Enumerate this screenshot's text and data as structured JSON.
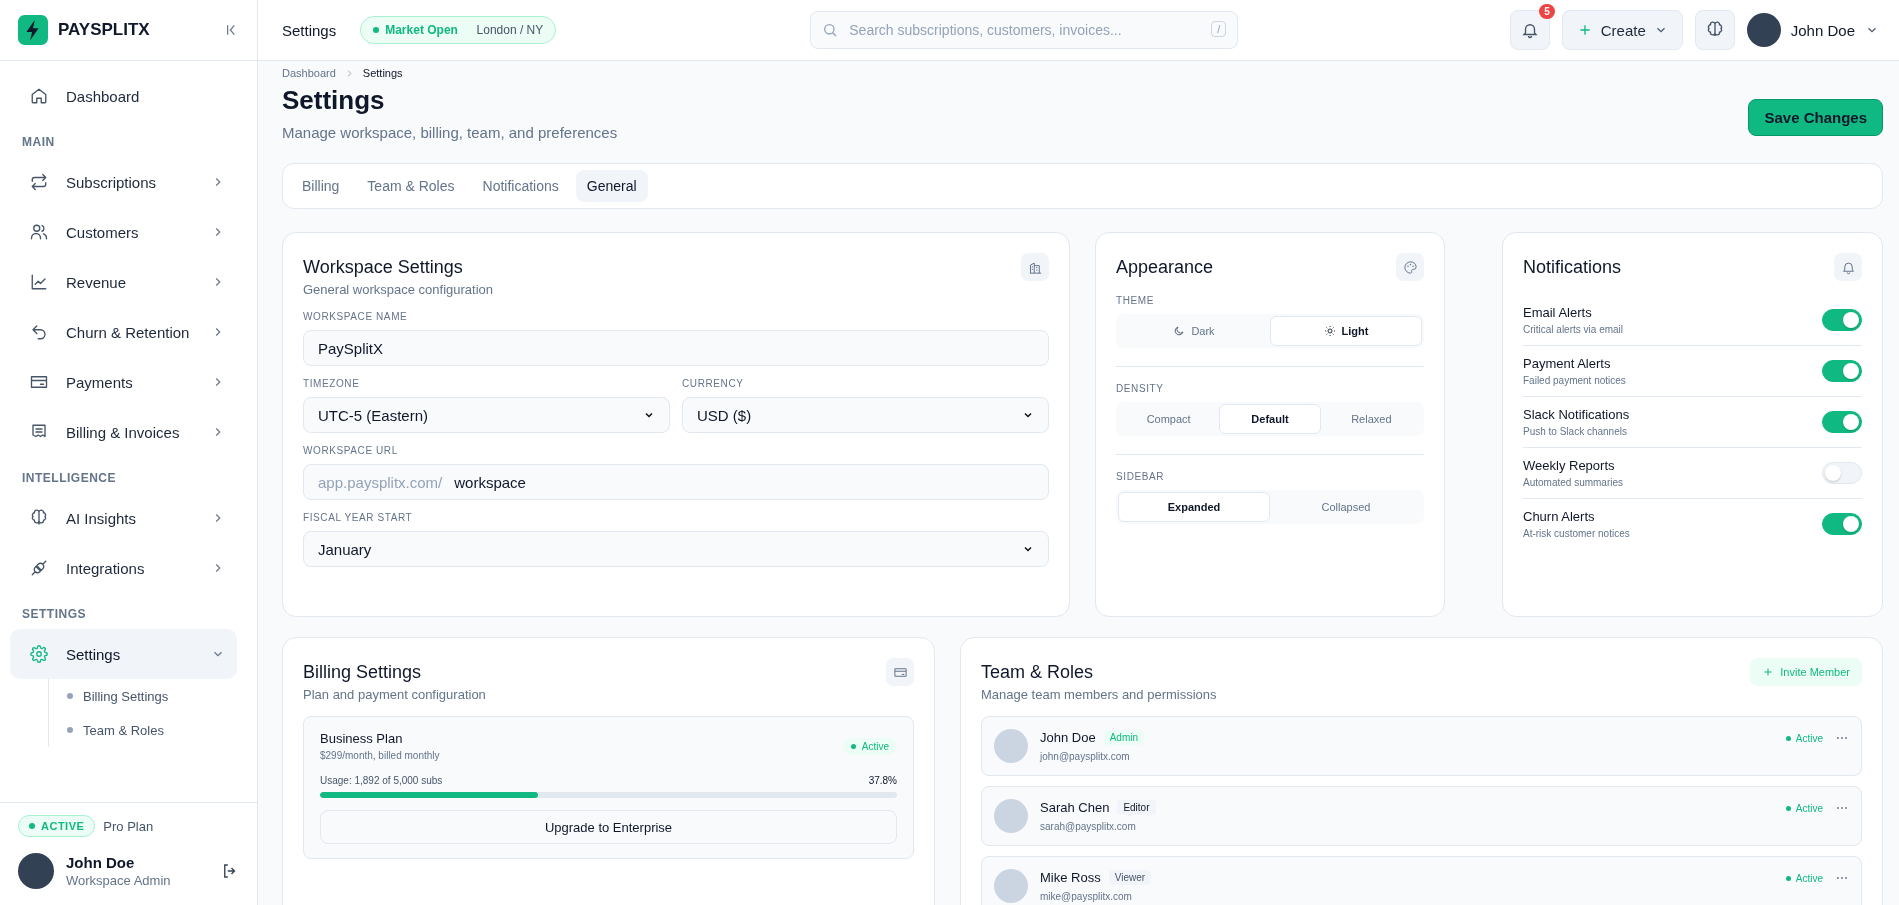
{
  "brand": {
    "name": "PAYSPLITX"
  },
  "sidebar": {
    "nav": [
      {
        "kind": "item",
        "label": "Dashboard",
        "selected": false
      },
      {
        "kind": "section",
        "label": "MAIN"
      },
      {
        "kind": "item",
        "label": "Subscriptions",
        "selected": false,
        "expanded": false
      },
      {
        "kind": "item",
        "label": "Customers",
        "selected": false,
        "expanded": false
      },
      {
        "kind": "item",
        "label": "Revenue",
        "selected": false,
        "expanded": false
      },
      {
        "kind": "item",
        "label": "Churn & Retention",
        "selected": false,
        "expanded": false
      },
      {
        "kind": "item",
        "label": "Payments",
        "selected": false,
        "expanded": false
      },
      {
        "kind": "item",
        "label": "Billing & Invoices",
        "selected": false,
        "expanded": false
      },
      {
        "kind": "section",
        "label": "INTELLIGENCE"
      },
      {
        "kind": "item",
        "label": "AI Insights",
        "selected": false,
        "expanded": false
      },
      {
        "kind": "item",
        "label": "Integrations",
        "selected": false,
        "expanded": false
      },
      {
        "kind": "section",
        "label": "SETTINGS"
      },
      {
        "kind": "item",
        "label": "Settings",
        "selected": true,
        "expanded": true,
        "children": [
          {
            "label": "Billing Settings"
          },
          {
            "label": "Team & Roles"
          }
        ]
      }
    ],
    "plan": {
      "badge": "ACTIVE",
      "name": "Pro Plan"
    },
    "user": {
      "name": "John Doe",
      "role": "Workspace Admin"
    }
  },
  "topbar": {
    "title": "Settings",
    "market": {
      "status": "Market Open",
      "location": "London / NY"
    },
    "search": {
      "placeholder": "Search subscriptions, customers, invoices...",
      "shortcut": "/"
    },
    "notification_count": "5",
    "create": "Create",
    "user": "John Doe"
  },
  "page": {
    "breadcrumb": [
      "Dashboard",
      "Settings"
    ],
    "title": "Settings",
    "subtitle": "Manage workspace, billing, team, and preferences",
    "save": "Save Changes",
    "tabs": [
      {
        "label": "Billing",
        "selected": false
      },
      {
        "label": "Team & Roles",
        "selected": false
      },
      {
        "label": "Notifications",
        "selected": false
      },
      {
        "label": "General",
        "selected": true
      }
    ]
  },
  "workspace": {
    "title": "Workspace Settings",
    "subtitle": "General workspace configuration",
    "name": {
      "label": "WORKSPACE NAME",
      "value": "PaySplitX"
    },
    "timezone": {
      "label": "TIMEZONE",
      "value": "UTC-5 (Eastern)"
    },
    "currency": {
      "label": "CURRENCY",
      "value": "USD ($)"
    },
    "url": {
      "label": "WORKSPACE URL",
      "prefix": "app.paysplitx.com/",
      "value": "workspace"
    },
    "fiscal": {
      "label": "FISCAL YEAR START",
      "value": "January"
    }
  },
  "appearance": {
    "title": "Appearance",
    "groups": [
      {
        "label": "THEME",
        "options": [
          {
            "label": "Dark",
            "selected": false
          },
          {
            "label": "Light",
            "selected": true
          }
        ]
      },
      {
        "label": "DENSITY",
        "options": [
          {
            "label": "Compact",
            "selected": false
          },
          {
            "label": "Default",
            "selected": true
          },
          {
            "label": "Relaxed",
            "selected": false
          }
        ]
      },
      {
        "label": "SIDEBAR",
        "options": [
          {
            "label": "Expanded",
            "selected": true
          },
          {
            "label": "Collapsed",
            "selected": false
          }
        ]
      }
    ]
  },
  "notifications": {
    "title": "Notifications",
    "items": [
      {
        "label": "Email Alerts",
        "description": "Critical alerts via email",
        "on": true
      },
      {
        "label": "Payment Alerts",
        "description": "Failed payment notices",
        "on": true
      },
      {
        "label": "Slack Notifications",
        "description": "Push to Slack channels",
        "on": true
      },
      {
        "label": "Weekly Reports",
        "description": "Automated summaries",
        "on": false
      },
      {
        "label": "Churn Alerts",
        "description": "At-risk customer notices",
        "on": true
      }
    ]
  },
  "billing": {
    "title": "Billing Settings",
    "subtitle": "Plan and payment configuration",
    "plan": "Business Plan",
    "price": "$299/month, billed monthly",
    "status": "Active",
    "usage": "Usage: 1,892 of 5,000 subs",
    "percent": "37.8%",
    "level": 0.378,
    "upgrade": "Upgrade to Enterprise"
  },
  "team": {
    "title": "Team & Roles",
    "subtitle": "Manage team members and permissions",
    "invite": "Invite Member",
    "members": [
      {
        "name": "John Doe",
        "role": "Admin",
        "kind": "admin",
        "email": "john@paysplitx.com",
        "status": "Active"
      },
      {
        "name": "Sarah Chen",
        "role": "Editor",
        "kind": "editor",
        "email": "sarah@paysplitx.com",
        "status": "Active"
      },
      {
        "name": "Mike Ross",
        "role": "Viewer",
        "kind": "viewer",
        "email": "mike@paysplitx.com",
        "status": "Active"
      }
    ]
  }
}
